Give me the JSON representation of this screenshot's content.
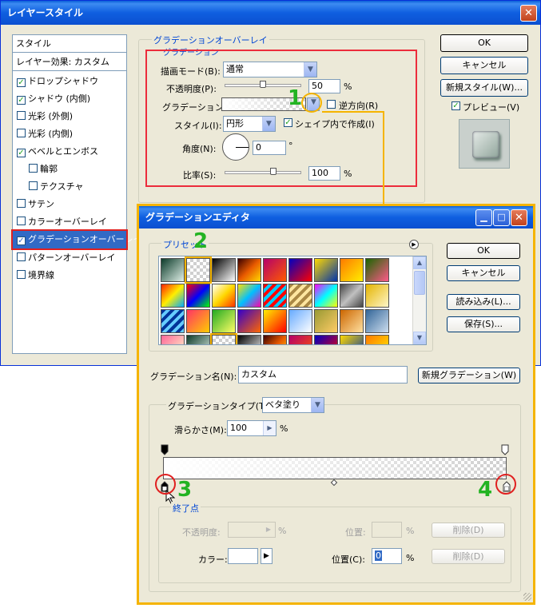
{
  "main_window": {
    "title": "レイヤースタイル",
    "left_panel": {
      "header1": "スタイル",
      "header2": "レイヤー効果: カスタム",
      "items": [
        {
          "label": "ドロップシャドウ",
          "checked": true
        },
        {
          "label": "シャドウ (内側)",
          "checked": true
        },
        {
          "label": "光彩 (外側)",
          "checked": false
        },
        {
          "label": "光彩 (内側)",
          "checked": false
        },
        {
          "label": "ベベルとエンボス",
          "checked": true
        },
        {
          "label": "輪郭",
          "checked": false
        },
        {
          "label": "テクスチャ",
          "checked": false
        },
        {
          "label": "サテン",
          "checked": false
        },
        {
          "label": "カラーオーバーレイ",
          "checked": false
        },
        {
          "label": "グラデーションオーバーレイ",
          "checked": true,
          "selected": true
        },
        {
          "label": "パターンオーバーレイ",
          "checked": false
        },
        {
          "label": "境界線",
          "checked": false
        }
      ]
    },
    "section_title": "グラデーションオーバーレイ",
    "sub_title": "グラデーション",
    "blend_mode_label": "描画モード(B):",
    "blend_mode_value": "通常",
    "opacity_label": "不透明度(P):",
    "opacity_value": "50",
    "gradient_label": "グラデーション:",
    "reverse_label": "逆方向(R)",
    "style_label": "スタイル(I):",
    "style_value": "円形",
    "align_label": "シェイプ内で作成(I)",
    "angle_label": "角度(N):",
    "angle_value": "0",
    "angle_unit": "°",
    "scale_label": "比率(S):",
    "scale_value": "100",
    "percent": "%",
    "ok": "OK",
    "cancel": "キャンセル",
    "new_style": "新規スタイル(W)...",
    "preview": "プレビュー(V)"
  },
  "editor": {
    "title": "グラデーションエディタ",
    "presets_label": "プリセット",
    "ok": "OK",
    "cancel": "キャンセル",
    "load": "読み込み(L)...",
    "save": "保存(S)...",
    "name_label": "グラデーション名(N):",
    "name_value": "カスタム",
    "new_gradient": "新規グラデーション(W)",
    "type_label": "グラデーションタイプ(T):",
    "type_value": "ベタ塗り",
    "smooth_label": "滑らかさ(M):",
    "smooth_value": "100",
    "percent": "%",
    "stops_title": "終了点",
    "stop_opacity_label": "不透明度:",
    "location_label_disabled": "位置:",
    "delete": "削除(D)",
    "color_label": "カラー:",
    "location_label": "位置(C):",
    "location_value": "0"
  },
  "annotations": [
    "1",
    "2",
    "3",
    "4"
  ]
}
